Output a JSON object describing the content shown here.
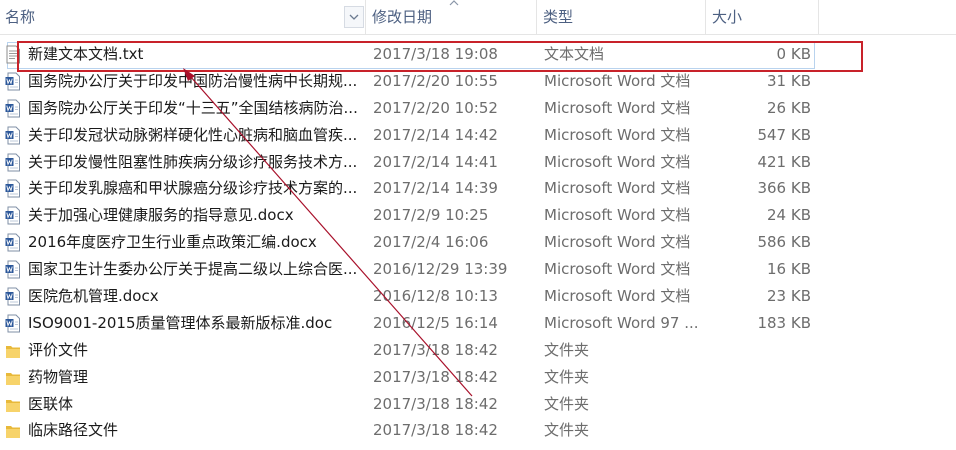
{
  "header": {
    "name": "名称",
    "date": "修改日期",
    "type": "类型",
    "size": "大小"
  },
  "colors": {
    "header_text": "#4d6082",
    "secondary_text": "#6d6d6d",
    "annotation": "#c8222a",
    "folder": "#e8b93a",
    "word_blue": "#2b579a"
  },
  "files": [
    {
      "name": "新建文本文档.txt",
      "date": "2017/3/18 19:08",
      "type": "文本文档",
      "size": "0 KB",
      "icon": "text-file-icon"
    },
    {
      "name": "国务院办公厅关于印发中国防治慢性病中长期规...",
      "date": "2017/2/20 10:55",
      "type": "Microsoft Word 文档",
      "size": "31 KB",
      "icon": "word-file-icon"
    },
    {
      "name": "国务院办公厅关于印发“十三五”全国结核病防治...",
      "date": "2017/2/20 10:52",
      "type": "Microsoft Word 文档",
      "size": "26 KB",
      "icon": "word-file-icon"
    },
    {
      "name": "关于印发冠状动脉粥样硬化性心脏病和脑血管疾...",
      "date": "2017/2/14 14:42",
      "type": "Microsoft Word 文档",
      "size": "547 KB",
      "icon": "word-file-icon"
    },
    {
      "name": "关于印发慢性阻塞性肺疾病分级诊疗服务技术方...",
      "date": "2017/2/14 14:41",
      "type": "Microsoft Word 文档",
      "size": "421 KB",
      "icon": "word-file-icon"
    },
    {
      "name": "关于印发乳腺癌和甲状腺癌分级诊疗技术方案的...",
      "date": "2017/2/14 14:39",
      "type": "Microsoft Word 文档",
      "size": "366 KB",
      "icon": "word-file-icon"
    },
    {
      "name": "关于加强心理健康服务的指导意见.docx",
      "date": "2017/2/9 10:25",
      "type": "Microsoft Word 文档",
      "size": "24 KB",
      "icon": "word-file-icon"
    },
    {
      "name": "2016年度医疗卫生行业重点政策汇编.docx",
      "date": "2017/2/4 16:06",
      "type": "Microsoft Word 文档",
      "size": "586 KB",
      "icon": "word-file-icon"
    },
    {
      "name": "国家卫生计生委办公厅关于提高二级以上综合医...",
      "date": "2016/12/29 13:39",
      "type": "Microsoft Word 文档",
      "size": "16 KB",
      "icon": "word-file-icon"
    },
    {
      "name": "医院危机管理.docx",
      "date": "2016/12/8 10:13",
      "type": "Microsoft Word 文档",
      "size": "23 KB",
      "icon": "word-file-icon"
    },
    {
      "name": "ISO9001-2015质量管理体系最新版标准.doc",
      "date": "2016/12/5 16:14",
      "type": "Microsoft Word 97 ...",
      "size": "183 KB",
      "icon": "word-file-icon"
    },
    {
      "name": "评价文件",
      "date": "2017/3/18 18:42",
      "type": "文件夹",
      "size": "",
      "icon": "folder-icon"
    },
    {
      "name": "药物管理",
      "date": "2017/3/18 18:42",
      "type": "文件夹",
      "size": "",
      "icon": "folder-icon"
    },
    {
      "name": "医联体",
      "date": "2017/3/18 18:42",
      "type": "文件夹",
      "size": "",
      "icon": "folder-icon"
    },
    {
      "name": "临床路径文件",
      "date": "2017/3/18 18:42",
      "type": "文件夹",
      "size": "",
      "icon": "folder-icon"
    }
  ]
}
